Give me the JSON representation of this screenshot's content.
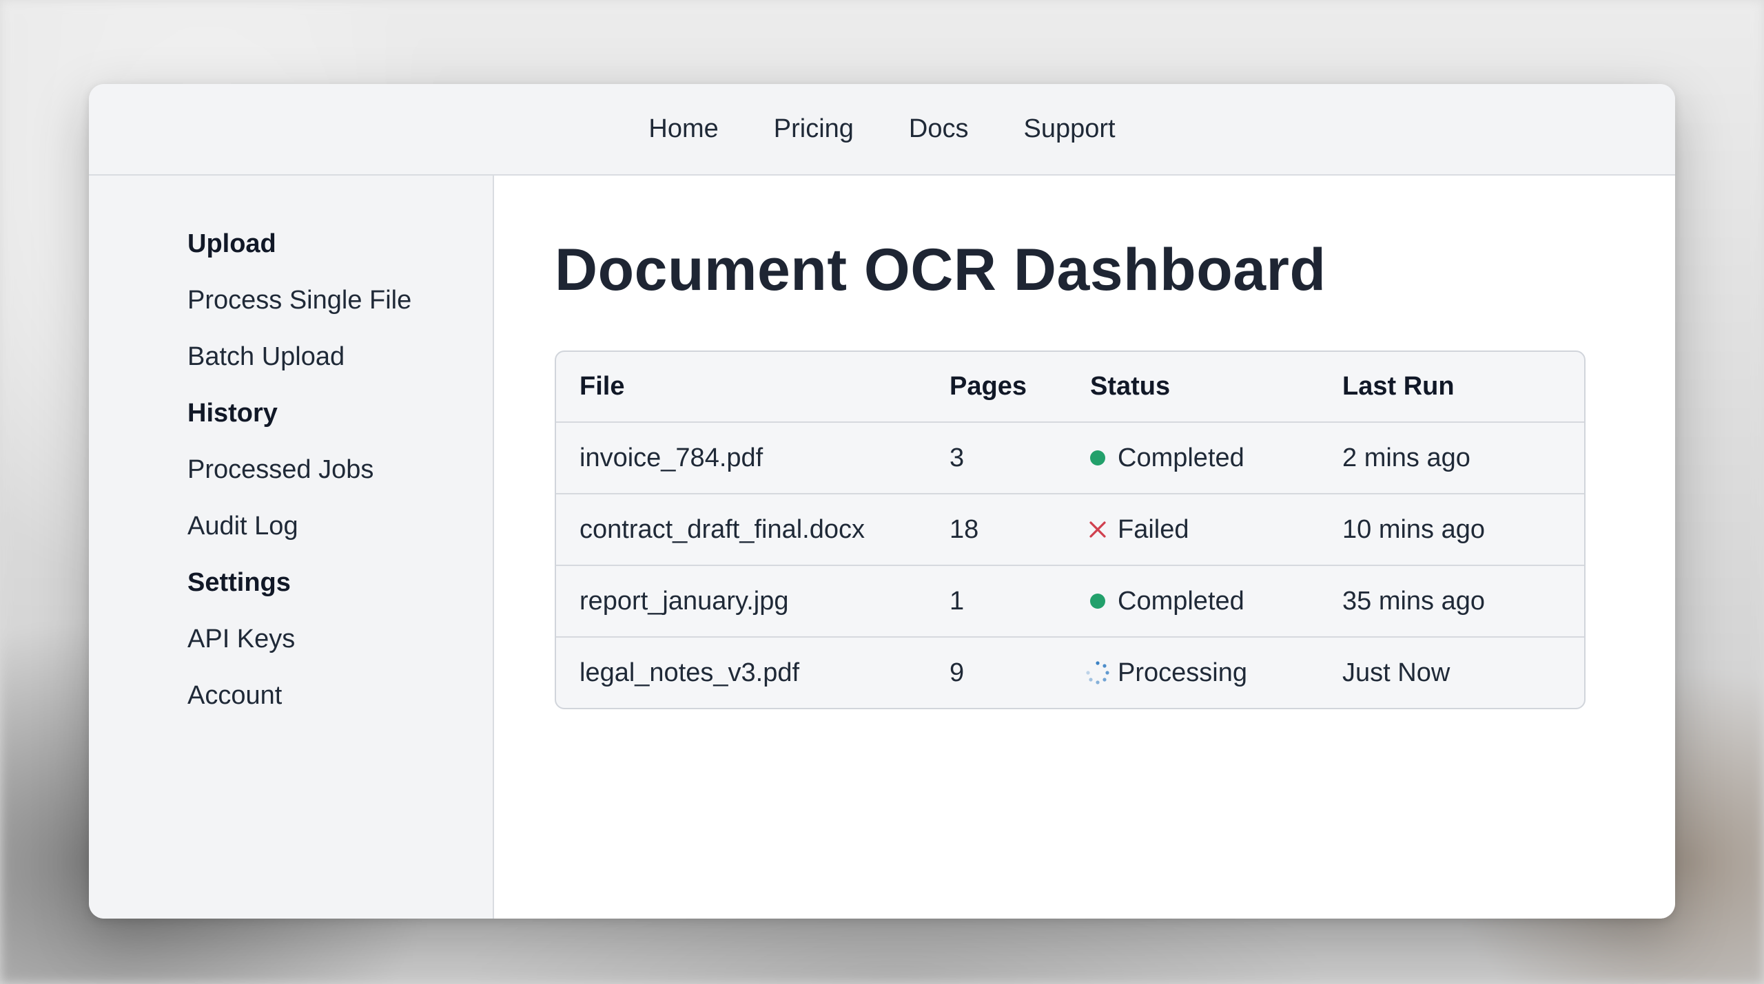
{
  "nav": {
    "items": [
      "Home",
      "Pricing",
      "Docs",
      "Support"
    ]
  },
  "sidebar": {
    "groups": [
      {
        "heading": "Upload",
        "items": [
          "Process Single File",
          "Batch Upload"
        ]
      },
      {
        "heading": "History",
        "items": [
          "Processed Jobs",
          "Audit Log"
        ]
      },
      {
        "heading": "Settings",
        "items": [
          "API Keys",
          "Account"
        ]
      }
    ]
  },
  "main": {
    "title": "Document OCR Dashboard",
    "table": {
      "headers": [
        "File",
        "Pages",
        "Status",
        "Last Run"
      ],
      "rows": [
        {
          "file": "invoice_784.pdf",
          "pages": "3",
          "status": "Completed",
          "status_icon": "green-dot-icon",
          "last_run": "2 mins ago"
        },
        {
          "file": "contract_draft_final.docx",
          "pages": "18",
          "status": "Failed",
          "status_icon": "red-x-icon",
          "last_run": "10 mins ago"
        },
        {
          "file": "report_january.jpg",
          "pages": "1",
          "status": "Completed",
          "status_icon": "green-dot-icon",
          "last_run": "35 mins ago"
        },
        {
          "file": "legal_notes_v3.pdf",
          "pages": "9",
          "status": "Processing",
          "status_icon": "spinner-icon",
          "last_run": "Just Now"
        }
      ]
    }
  },
  "colors": {
    "completed": "#22a06b",
    "failed": "#d0404e",
    "processing": "#3b82c4",
    "title": "#1e2533"
  }
}
